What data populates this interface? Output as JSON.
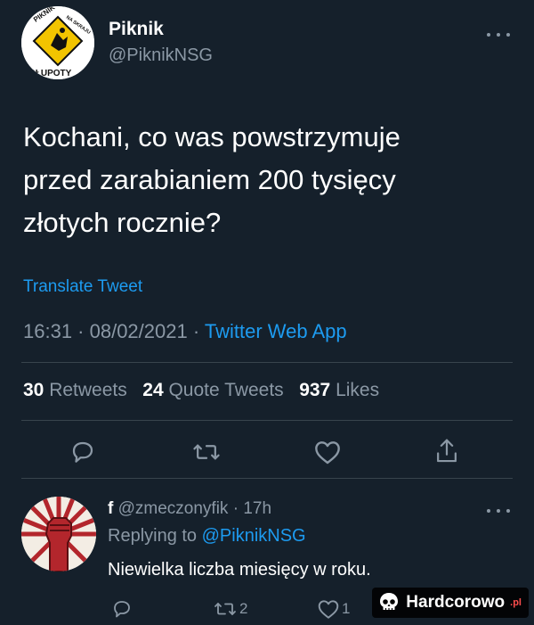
{
  "tweet": {
    "author_name": "Piknik",
    "author_handle": "@PiknikNSG",
    "avatar_text_top": "PIKNIK",
    "avatar_text_right": "NA SKRAJU",
    "avatar_text_bottom": "GŁUPOTY",
    "text_line1": "Kochani, co was powstrzymuje",
    "text_line2": "przed zarabianiem 200 tysięcy",
    "text_line3": "złotych rocznie?",
    "translate": "Translate Tweet",
    "time": "16:31 · 08/02/2021 · ",
    "source": "Twitter Web App",
    "retweets_count": "30",
    "retweets_label": "Retweets",
    "quotes_count": "24",
    "quotes_label": "Quote Tweets",
    "likes_count": "937",
    "likes_label": "Likes"
  },
  "reply": {
    "author_name": "f",
    "author_handle": "@zmeczonyfik",
    "time": "· 17h",
    "replying_to_label": "Replying to ",
    "replying_to_handle": "@PiknikNSG",
    "text": "Niewielka liczba miesięcy w roku.",
    "retweet_count": "2",
    "like_count": "1"
  },
  "watermark": {
    "brand": "Hardcorowo",
    "tld": ".pl"
  },
  "colors": {
    "background": "#15202b",
    "text": "#ffffff",
    "muted": "#8b98a5",
    "accent": "#1d9bf0",
    "divider": "#38444d"
  },
  "icons": [
    "more-icon",
    "reply-icon",
    "retweet-icon",
    "like-icon",
    "share-icon",
    "skull-icon"
  ]
}
